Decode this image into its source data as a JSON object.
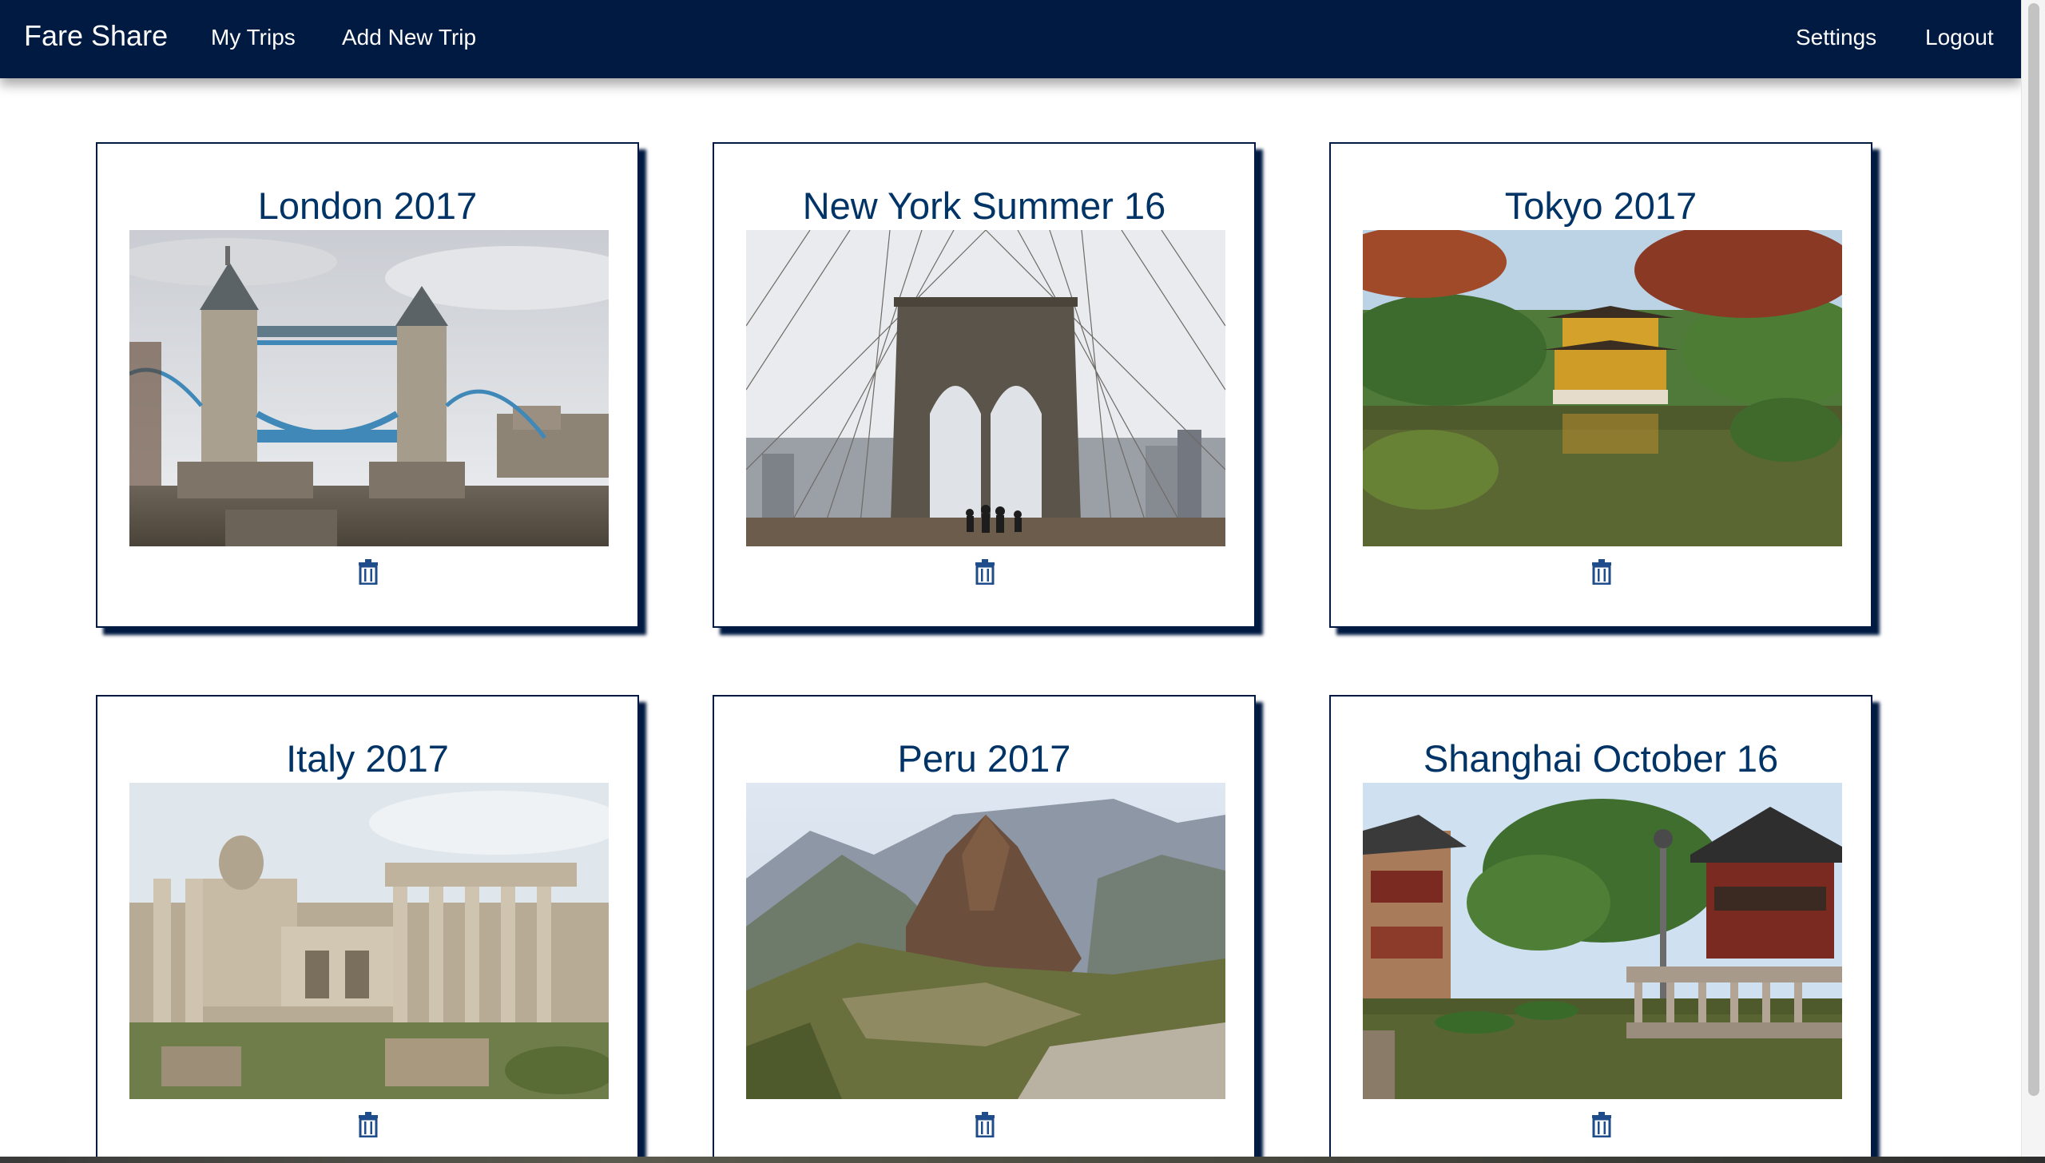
{
  "app": {
    "brand": "Fare Share"
  },
  "nav": {
    "left": [
      "My Trips",
      "Add New Trip"
    ],
    "right": [
      "Settings",
      "Logout"
    ]
  },
  "trips": [
    {
      "title": "London 2017",
      "photo": "tower-bridge-photo"
    },
    {
      "title": "New York Summer 16",
      "photo": "brooklyn-bridge-photo"
    },
    {
      "title": "Tokyo 2017",
      "photo": "golden-pavilion-photo"
    },
    {
      "title": "Italy 2017",
      "photo": "roman-forum-photo"
    },
    {
      "title": "Peru 2017",
      "photo": "machu-picchu-photo"
    },
    {
      "title": "Shanghai October 16",
      "photo": "yu-garden-photo"
    }
  ],
  "icons": {
    "delete": "trash-icon"
  },
  "colors": {
    "navbar": "#001a42",
    "title": "#003366",
    "card_shadow": "#001a42"
  }
}
